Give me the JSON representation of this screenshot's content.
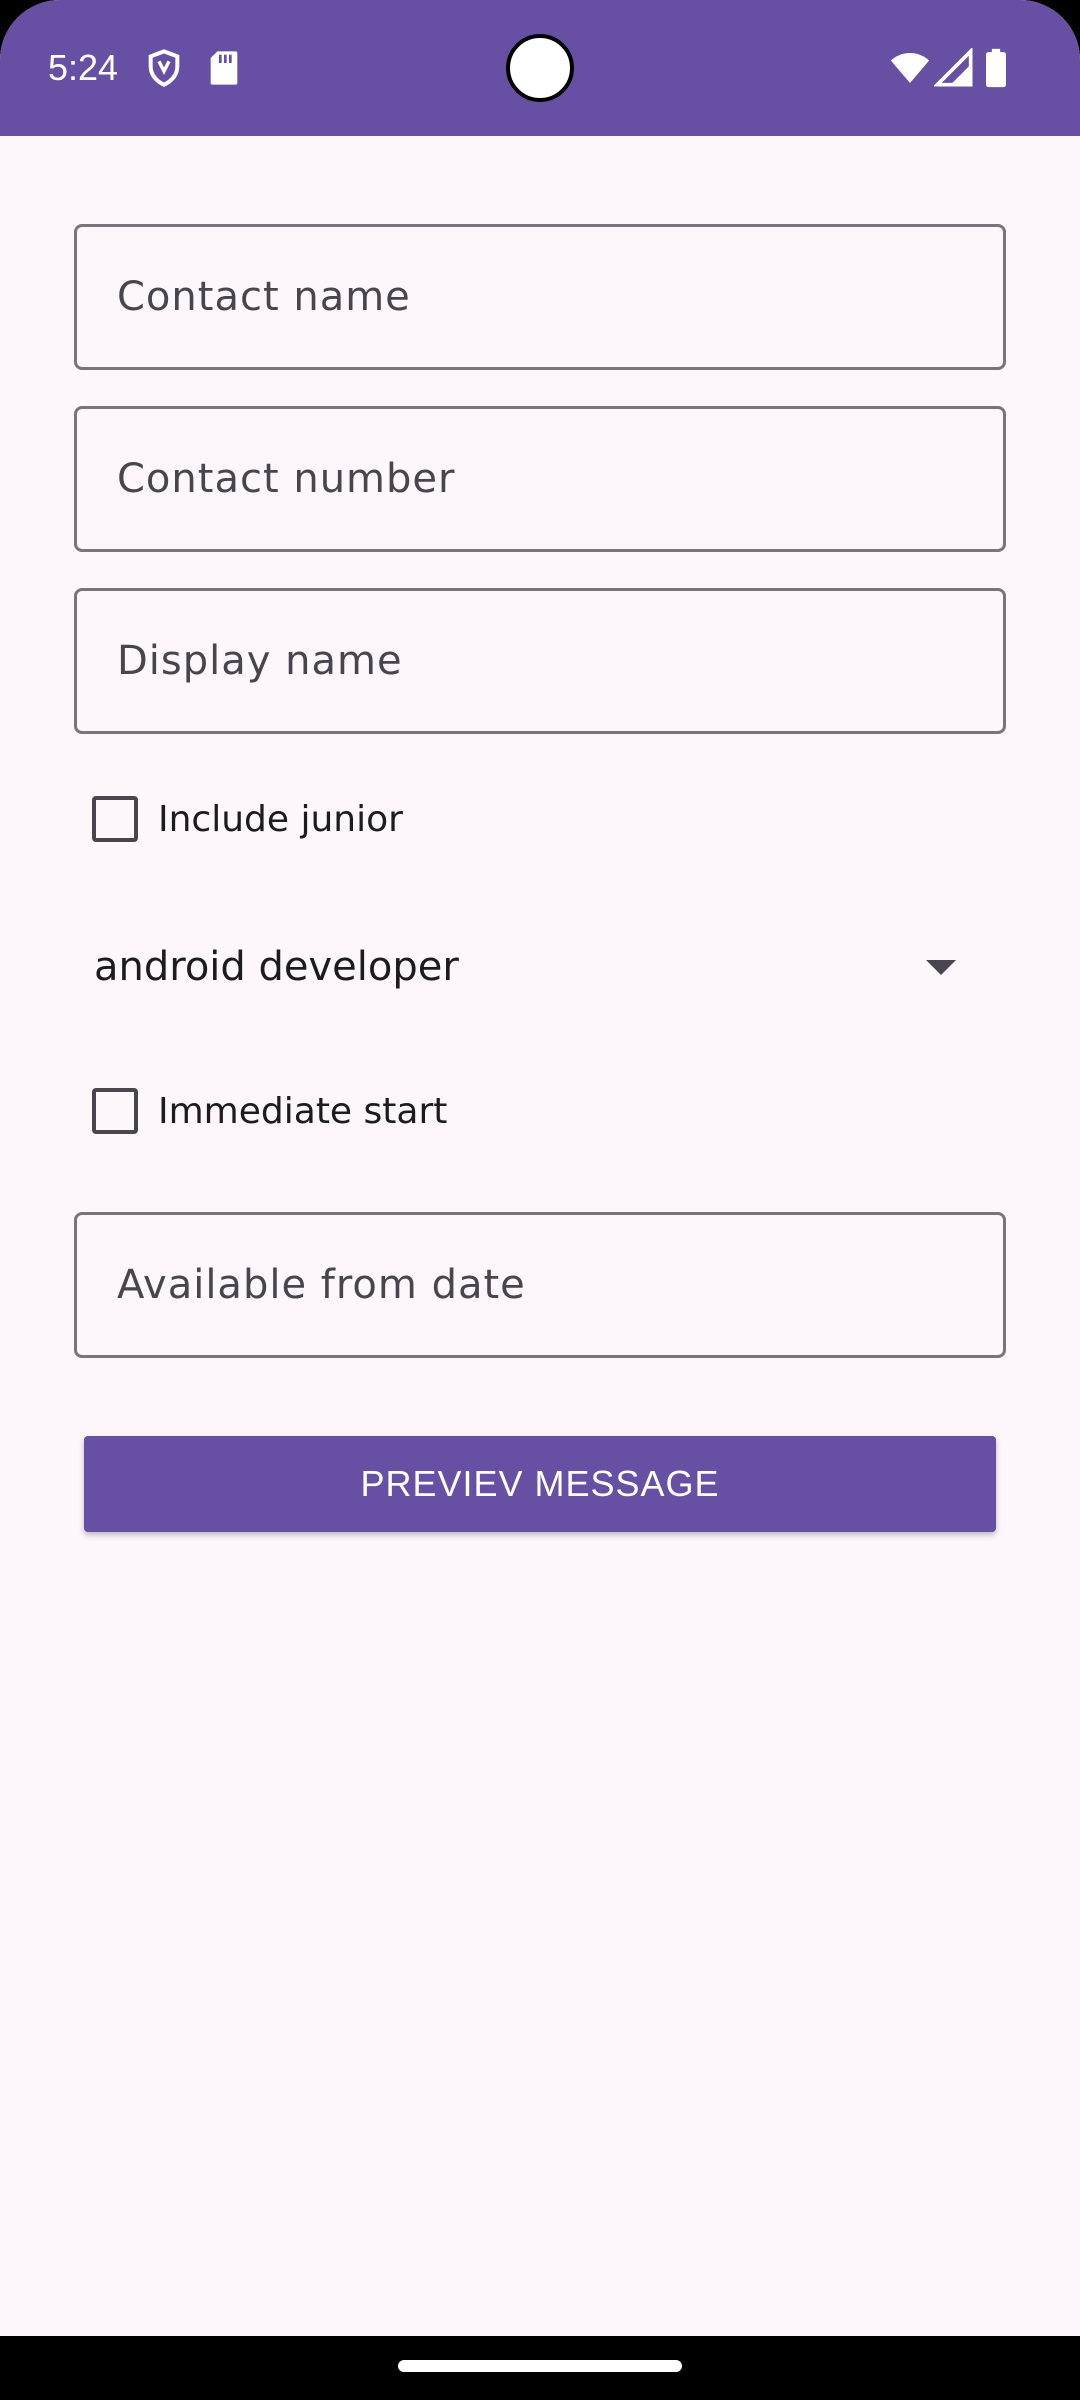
{
  "status_bar": {
    "time": "5:24",
    "left_icons": [
      "shield-icon",
      "sd-card-icon"
    ],
    "right_icons": [
      "wifi-icon",
      "signal-icon",
      "battery-icon"
    ],
    "background": "#6750a4"
  },
  "form": {
    "contact_name": {
      "placeholder": "Contact name",
      "value": ""
    },
    "contact_number": {
      "placeholder": "Contact number",
      "value": ""
    },
    "display_name": {
      "placeholder": "Display name",
      "value": ""
    },
    "include_junior": {
      "label": "Include junior",
      "checked": false
    },
    "position": {
      "selected": "android developer"
    },
    "immediate_start": {
      "label": "Immediate start",
      "checked": false
    },
    "available_from": {
      "placeholder": "Available from date",
      "value": ""
    }
  },
  "actions": {
    "preview_label": "PREVIEV MESSAGE"
  },
  "colors": {
    "primary": "#6750a4",
    "surface": "#fdf7fc",
    "outline": "#79747e",
    "on_surface": "#1c1b1f"
  }
}
